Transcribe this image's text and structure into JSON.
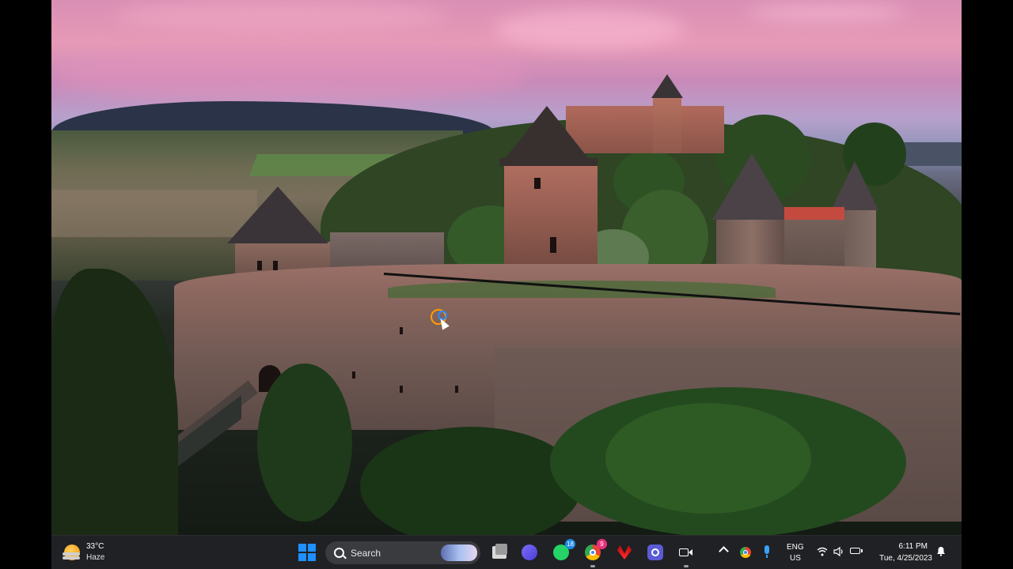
{
  "taskbar": {
    "weather": {
      "temperature": "33°C",
      "condition": "Haze",
      "icon": "sun-haze-icon"
    },
    "search": {
      "label": "Search"
    },
    "apps": [
      {
        "name": "file-explorer-icon",
        "badge": ""
      },
      {
        "name": "meet-app-icon",
        "badge": ""
      },
      {
        "name": "whatsapp-icon",
        "badge": "18"
      },
      {
        "name": "chrome-icon",
        "badge": "9"
      },
      {
        "name": "huawei-icon",
        "badge": ""
      },
      {
        "name": "screen-recorder-icon",
        "badge": ""
      },
      {
        "name": "camera-icon",
        "badge": ""
      }
    ],
    "tray": {
      "language_line1": "ENG",
      "language_line2": "US",
      "time": "6:11 PM",
      "date": "Tue, 4/25/2023"
    }
  },
  "colors": {
    "taskbar_bg": "#202124",
    "accent": "#1e90ff",
    "whatsapp_badge": "#1e88e5",
    "chrome_badge": "#e8327c"
  }
}
